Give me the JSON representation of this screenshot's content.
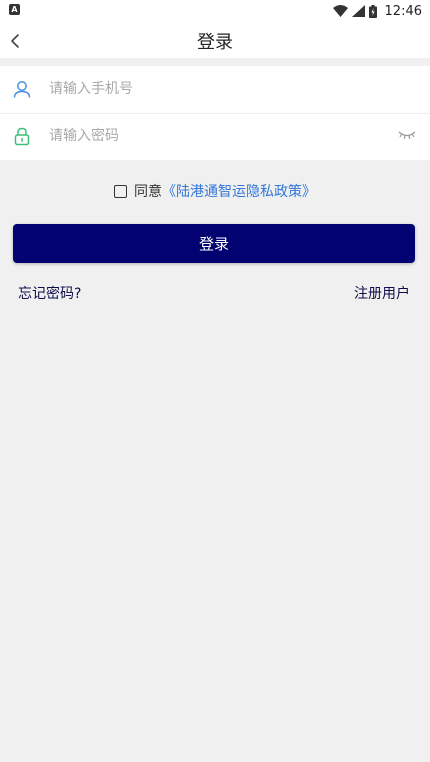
{
  "status_bar": {
    "time": "12:46",
    "icons": [
      "app-notification-icon",
      "wifi-icon",
      "cell-signal-icon",
      "battery-icon"
    ]
  },
  "nav": {
    "title": "登录",
    "back_icon": "chevron-left-icon"
  },
  "form": {
    "phone": {
      "placeholder": "请输入手机号",
      "value": "",
      "icon": "user-icon",
      "icon_color": "#4a90e2"
    },
    "password": {
      "placeholder": "请输入密码",
      "value": "",
      "icon": "lock-icon",
      "icon_color": "#3bbf7a",
      "toggle_icon": "eye-closed-icon"
    }
  },
  "agreement": {
    "checked": false,
    "prefix": "同意",
    "link": "《陆港通智运隐私政策》"
  },
  "login_button": {
    "label": "登录",
    "color": "#020270"
  },
  "links": {
    "forgot_password": "忘记密码?",
    "register": "注册用户"
  }
}
